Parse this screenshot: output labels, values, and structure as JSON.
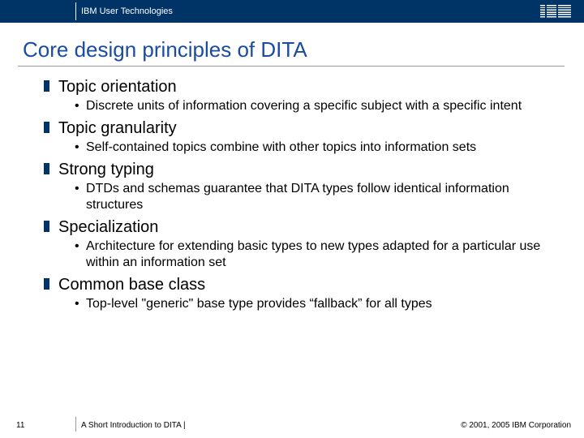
{
  "header": {
    "label": "IBM User Technologies",
    "logo_alt": "IBM"
  },
  "slide": {
    "title": "Core design principles of DITA",
    "bullets": [
      {
        "heading": "Topic orientation",
        "sub": "Discrete units of information covering a specific subject with a specific intent"
      },
      {
        "heading": "Topic granularity",
        "sub": "Self-contained topics combine with other topics into information sets"
      },
      {
        "heading": "Strong typing",
        "sub": "DTDs and schemas guarantee that DITA types follow identical information structures"
      },
      {
        "heading": "Specialization",
        "sub": "Architecture for extending basic types to new types adapted for a particular use within an information set"
      },
      {
        "heading": "Common base class",
        "sub": "Top-level \"generic\" base type provides “fallback” for all types"
      }
    ]
  },
  "footer": {
    "page_number": "11",
    "deck_title": "A Short Introduction to DITA |",
    "copyright": "© 2001, 2005 IBM Corporation"
  }
}
